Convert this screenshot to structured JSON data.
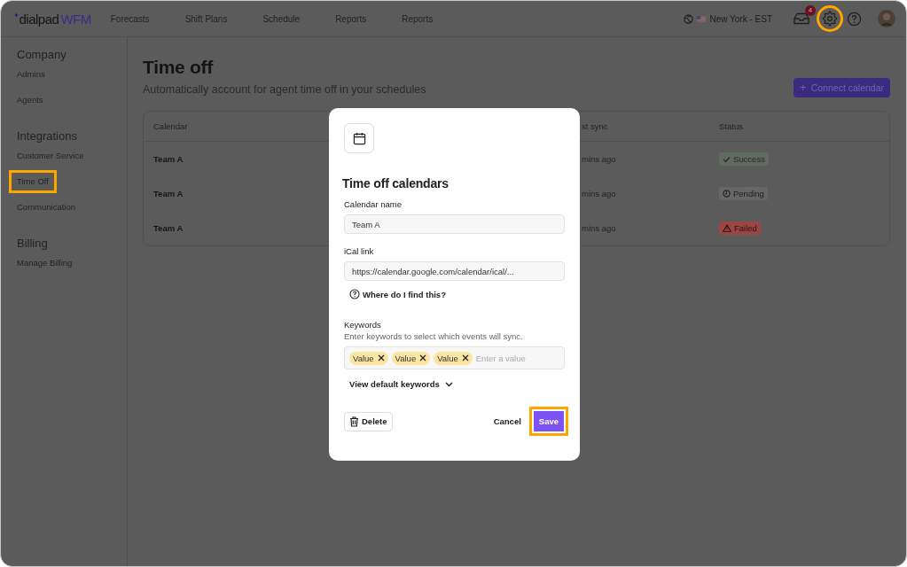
{
  "app": {
    "logo_mark": "✦",
    "logo_main": "dialpad",
    "logo_product": "WFM"
  },
  "nav": [
    "Forecasts",
    "Shift Plans",
    "Schedule",
    "Reports",
    "Reports"
  ],
  "topbar": {
    "timezone": "New York - EST",
    "inbox_badge": "4",
    "settings_highlighted": true
  },
  "sidebar": {
    "sections": [
      {
        "title": "Company",
        "items": [
          {
            "label": "Admins",
            "highlighted": false
          },
          {
            "label": "Agents",
            "highlighted": false
          }
        ]
      },
      {
        "title": "Integrations",
        "items": [
          {
            "label": "Customer Service",
            "highlighted": false
          },
          {
            "label": "Time Off",
            "highlighted": true
          },
          {
            "label": "Communication",
            "highlighted": false
          }
        ]
      },
      {
        "title": "Billing",
        "items": [
          {
            "label": "Manage Billing",
            "highlighted": false
          }
        ]
      }
    ]
  },
  "page": {
    "title": "Time off",
    "subtitle": "Automatically account for agent time off in your schedules",
    "connect_icon": "+",
    "connect_button": "Connect calendar"
  },
  "table": {
    "columns": [
      "Calendar",
      "st sync",
      "Status"
    ],
    "rows": [
      {
        "calendar": "Team A",
        "last_sync": "mins ago",
        "status": {
          "label": "Success",
          "kind": "success"
        }
      },
      {
        "calendar": "Team A",
        "last_sync": "mins ago",
        "status": {
          "label": "Pending",
          "kind": "pending"
        }
      },
      {
        "calendar": "Team A",
        "last_sync": "mins ago",
        "status": {
          "label": "Failed",
          "kind": "failed"
        }
      }
    ]
  },
  "modal": {
    "title": "Time off calendars",
    "name_label": "Calendar name",
    "name_value": "Team A",
    "link_label": "iCal link",
    "link_value": "https://calendar.google.com/calendar/ical/...",
    "help_link": "Where do I find this?",
    "keywords_label": "Keywords",
    "keywords_hint": "Enter keywords to select which events will sync.",
    "keywords": [
      "Value",
      "Value",
      "Value"
    ],
    "keywords_placeholder": "Enter a value",
    "view_defaults": "View default keywords",
    "delete_button": "Delete",
    "cancel_button": "Cancel",
    "save_button": {
      "label": "Save",
      "highlighted": true
    }
  }
}
